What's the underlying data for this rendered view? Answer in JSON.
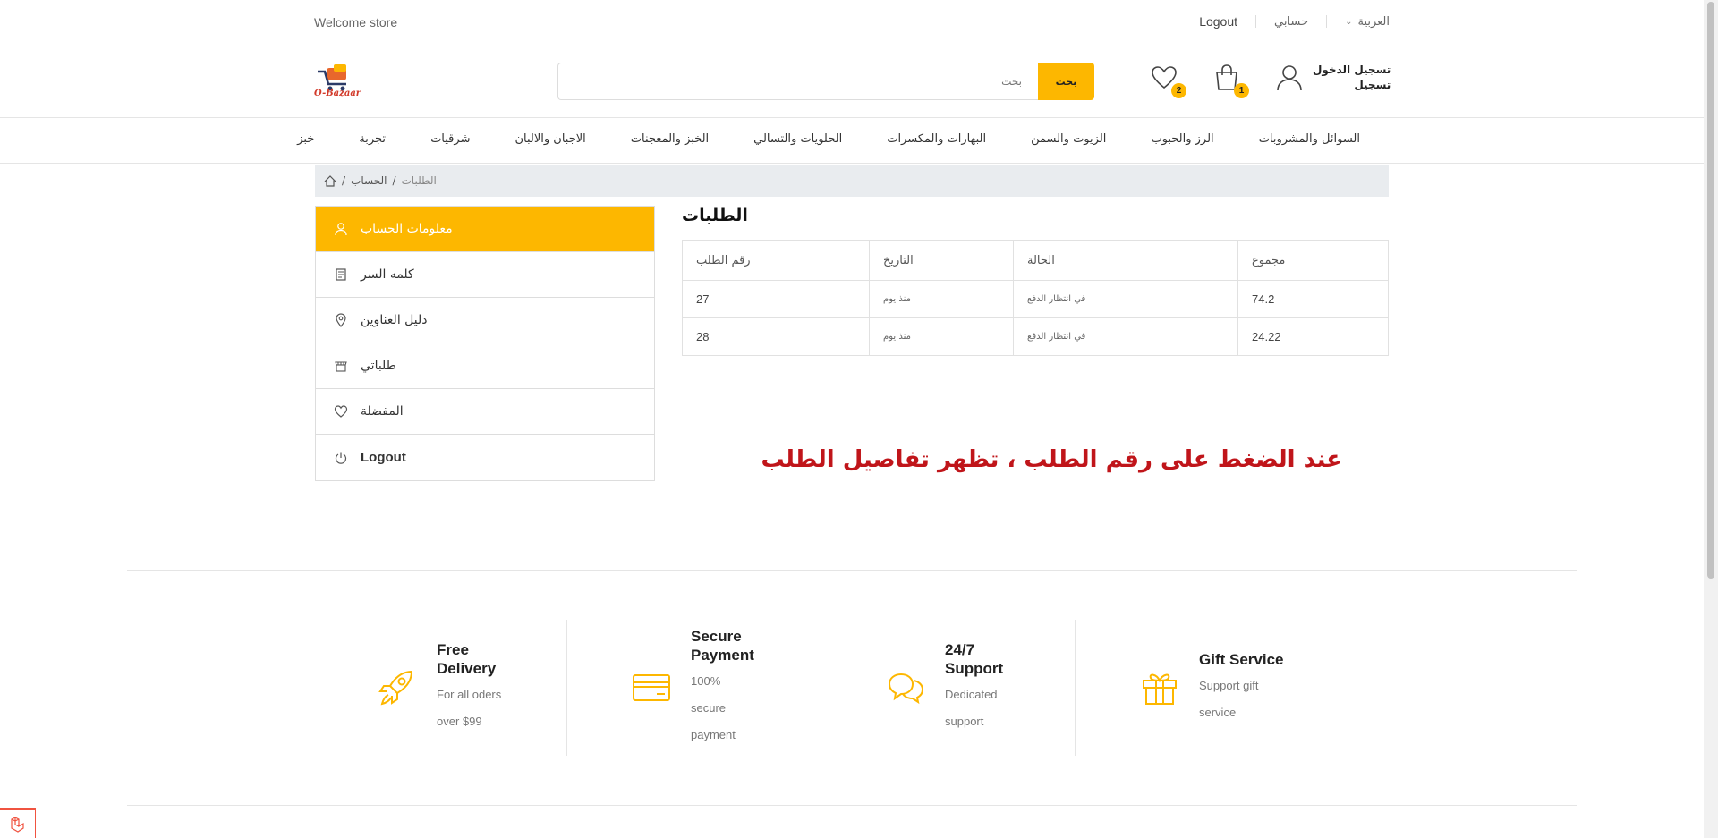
{
  "topbar": {
    "welcome": "Welcome store",
    "logout": "Logout",
    "my_account": "حسابي",
    "language": "العربية"
  },
  "header": {
    "logo_text": "O-Bazaar",
    "search_placeholder": "بحث",
    "search_button": "بحث",
    "wishlist_count": "2",
    "cart_count": "1",
    "login": "تسجيل الدخول",
    "register": "تسجيل"
  },
  "nav": {
    "items": [
      "السوائل والمشروبات",
      "الرز والحبوب",
      "الزيوت والسمن",
      "البهارات والمكسرات",
      "الحلويات والتسالي",
      "الخبز والمعجنات",
      "الاجبان والالبان",
      "شرقيات",
      "تجربة",
      "خبز"
    ]
  },
  "breadcrumb": {
    "account": "الحساب",
    "current": "الطلبات"
  },
  "sidebar": {
    "items": [
      {
        "label": "معلومات الحساب",
        "icon": "user-icon"
      },
      {
        "label": "كلمه السر",
        "icon": "document-icon"
      },
      {
        "label": "دليل العناوين",
        "icon": "map-pin-icon"
      },
      {
        "label": "طلباتي",
        "icon": "store-icon"
      },
      {
        "label": "المفضلة",
        "icon": "heart-icon"
      },
      {
        "label": "Logout",
        "icon": "power-icon"
      }
    ]
  },
  "orders": {
    "title": "الطلبات",
    "columns": [
      "رقم الطلب",
      "التاريخ",
      "الحالة",
      "مجموع"
    ],
    "rows": [
      {
        "id": "27",
        "date": "منذ يوم",
        "status": "في انتظار الدفع",
        "total": "74.2"
      },
      {
        "id": "28",
        "date": "منذ يوم",
        "status": "في انتظار الدفع",
        "total": "24.22"
      }
    ]
  },
  "note": "عند الضغط على رقم الطلب ، تظهر تفاصيل الطلب",
  "features": [
    {
      "title": "Free Delivery",
      "desc": "For all oders over $99",
      "icon": "rocket-icon"
    },
    {
      "title": "Secure Payment",
      "desc": "100% secure payment",
      "icon": "credit-card-icon"
    },
    {
      "title": "24/7 Support",
      "desc": "Dedicated support",
      "icon": "chat-icon"
    },
    {
      "title": "Gift Service",
      "desc": "Support gift service",
      "icon": "gift-icon"
    }
  ],
  "colors": {
    "accent": "#fdb700",
    "note": "#c0151a"
  }
}
